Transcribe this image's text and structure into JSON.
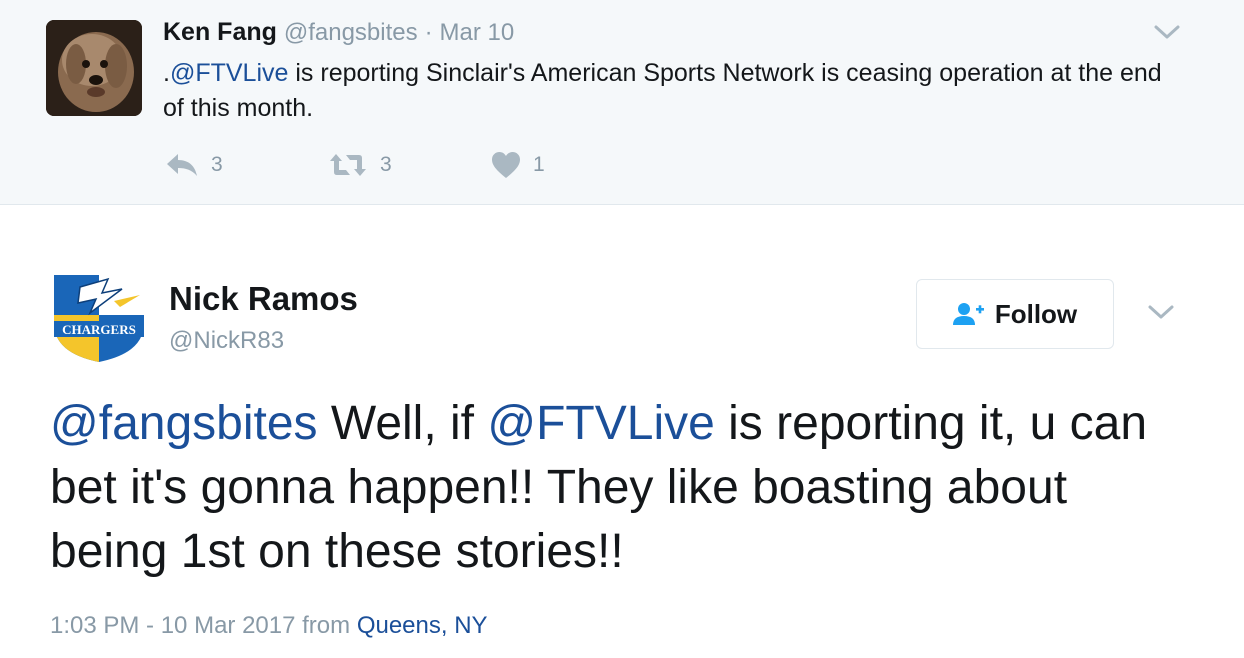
{
  "parent_tweet": {
    "name": "Ken Fang",
    "handle": "@fangsbites",
    "separator": "·",
    "date": "Mar 10",
    "text_lead": ".",
    "mention": "@FTVLive",
    "text_rest": " is reporting Sinclair's American Sports Network is ceasing operation at the end of this month.",
    "reply_count": "3",
    "retweet_count": "3",
    "like_count": "1",
    "icons": {
      "avatar": "dog-avatar",
      "reply": "reply-icon",
      "retweet": "retweet-icon",
      "like": "heart-icon",
      "menu": "chevron-down-icon"
    }
  },
  "main_tweet": {
    "name": "Nick Ramos",
    "handle": "@NickR83",
    "avatar_text": "CHARGERS",
    "follow_label": "Follow",
    "text_mention1": "@fangsbites",
    "text_part1": " Well, if ",
    "text_mention2": "@FTVLive",
    "text_part2": " is reporting it, u can bet it's gonna happen!! They like boasting about being 1st on these stories!!",
    "timestamp": "1:03 PM - 10 Mar 2017",
    "from_label": " from ",
    "location": "Queens, NY",
    "icons": {
      "follow": "add-user-icon",
      "menu": "chevron-down-icon"
    }
  },
  "colors": {
    "link": "#1b4f99",
    "muted": "#8899a6",
    "text": "#14171a",
    "parent_bg": "#f5f8fa",
    "border": "#e1e8ed",
    "follow_icon": "#1da1f2",
    "icon_gray": "#aab8c2"
  }
}
